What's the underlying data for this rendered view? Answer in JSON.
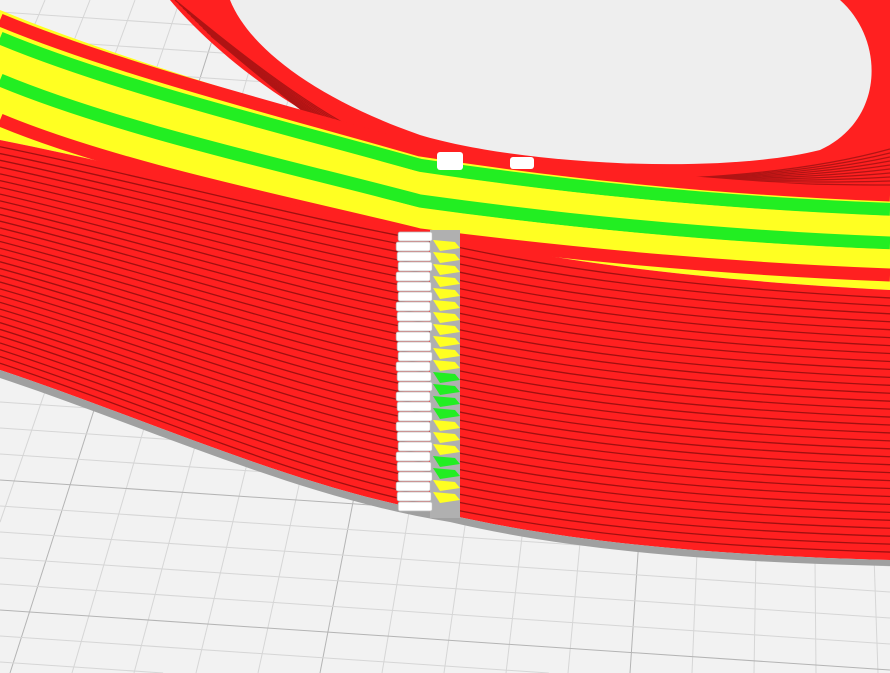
{
  "viewport": {
    "background_color": "#f2f2f2",
    "grid_color": "#d6d6d6",
    "grid_major_color": "#b4b4b4"
  },
  "layer_colors": {
    "outer_wall": "#ff2020",
    "inner_wall": "#22ee22",
    "infill": "#ffff22",
    "travel_seam": "#ffffff",
    "shadow": "#a0a0a0"
  }
}
